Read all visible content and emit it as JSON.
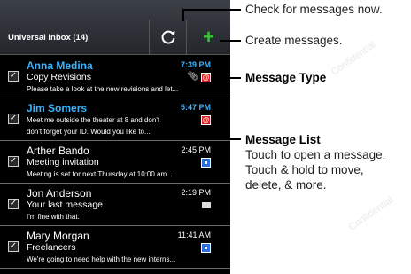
{
  "inbox": {
    "title": "Universal Inbox (14)",
    "refresh_icon": "refresh-icon",
    "add_icon": "plus-icon",
    "accent_color": "#3ab3ff",
    "add_color": "#39c43a"
  },
  "messages": [
    {
      "sender": "Anna Medina",
      "time": "7:39 PM",
      "subject": "Copy Revisions",
      "preview": "Please take a look at the new revisions and let...",
      "unread": true,
      "type_icon": "email-icon",
      "attachment_icon": "paperclip-icon"
    },
    {
      "sender": "Jim Somers",
      "time": "5:47 PM",
      "subject": "Meet me outside the theater at 8 and don't",
      "preview": "don't forget your ID. Would you like to...",
      "unread": true,
      "type_icon": "email-icon"
    },
    {
      "sender": "Arther Bando",
      "time": "2:45 PM",
      "subject": "Meeting invitation",
      "preview": "Meeting is set for next Thursday at 10:00 am...",
      "unread": false,
      "type_icon": "calendar-icon"
    },
    {
      "sender": "Jon Anderson",
      "time": "2:19 PM",
      "subject": "Your last message",
      "preview": "I'm fine with that.",
      "unread": false,
      "type_icon": "sms-icon"
    },
    {
      "sender": "Mary Morgan",
      "time": "11:41 AM",
      "subject": "Freelancers",
      "preview": "We're going to need help with the new interns...",
      "unread": false,
      "type_icon": "calendar-icon"
    }
  ],
  "callouts": {
    "check": "Check for messages now.",
    "create": "Create messages.",
    "type_heading": "Message Type",
    "list_heading": "Message List",
    "list_line1": "Touch to open a message.",
    "list_line2": "Touch & hold to move,",
    "list_line3": "delete, & more."
  },
  "watermark": "Confidential"
}
